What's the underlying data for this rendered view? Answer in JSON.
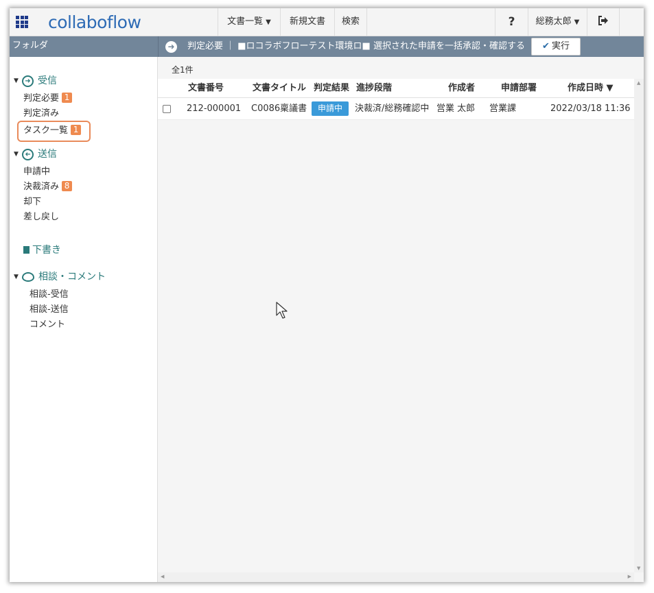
{
  "header": {
    "logo": "collaboflow",
    "nav": {
      "doc_list": "文書一覧",
      "new_doc": "新規文書",
      "search": "検索",
      "help": "?",
      "user": "総務太郎"
    }
  },
  "folder_bar": {
    "title": "フォルダ",
    "action_text": "判定必要 ｜ ■ロコラボフローテスト環境ロ■ 選択された申請を一括承認・確認する",
    "exec_label": "実行"
  },
  "sidebar": {
    "received": {
      "label": "受信",
      "items": [
        {
          "label": "判定必要",
          "badge": "1"
        },
        {
          "label": "判定済み"
        },
        {
          "label": "タスク一覧",
          "badge": "1"
        }
      ]
    },
    "sent": {
      "label": "送信",
      "items": [
        {
          "label": "申請中"
        },
        {
          "label": "決裁済み",
          "badge": "8"
        },
        {
          "label": "却下"
        },
        {
          "label": "差し戻し"
        }
      ]
    },
    "draft": {
      "label": "下書き"
    },
    "consult": {
      "label": "相談・コメント",
      "items": [
        {
          "label": "相談-受信"
        },
        {
          "label": "相談-送信"
        },
        {
          "label": "コメント"
        }
      ]
    }
  },
  "main": {
    "count": "全1件",
    "columns": [
      "文書番号",
      "文書タイトル",
      "判定結果",
      "進捗段階",
      "作成者",
      "申請部署",
      "作成日時 ▼"
    ],
    "rows": [
      {
        "doc_no": "212-000001",
        "title": "C0086稟議書",
        "status": "申請中",
        "progress": "決裁済/総務確認中",
        "author": "営業 太郎",
        "dept": "営業課",
        "created": "2022/03/18 11:36"
      }
    ]
  },
  "colors": {
    "brand": "#2e6bb5",
    "folder_bar": "#72869a",
    "accent_teal": "#2a7a7a",
    "badge_orange": "#ef8a4f",
    "status_blue": "#3a9ad9"
  }
}
